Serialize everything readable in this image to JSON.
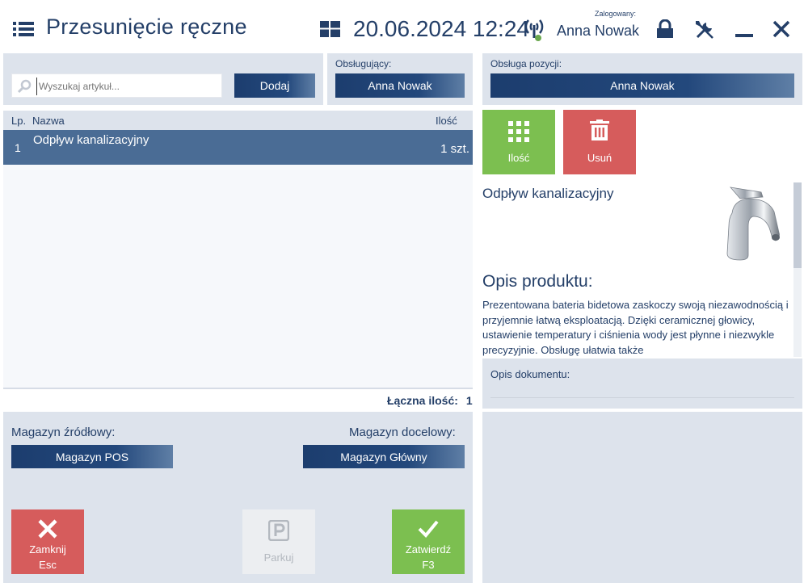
{
  "header": {
    "title": "Przesunięcie ręczne",
    "datetime": "20.06.2024 12:24",
    "logged_label": "Zalogowany:",
    "logged_user": "Anna Nowak"
  },
  "search": {
    "placeholder": "Wyszukaj artykuł...",
    "add_label": "Dodaj"
  },
  "operator": {
    "label": "Obsługujący:",
    "value": "Anna Nowak"
  },
  "position_operator": {
    "label": "Obsługa pozycji:",
    "value": "Anna Nowak"
  },
  "table": {
    "columns": [
      "Lp.",
      "Nazwa",
      "Ilość"
    ],
    "rows": [
      {
        "lp": "1",
        "name": "Odpływ kanalizacyjny",
        "qty": "1 szt."
      }
    ],
    "total_label": "Łączna ilość:",
    "total_value": "1"
  },
  "actions": {
    "qty_label": "Ilość",
    "delete_label": "Usuń"
  },
  "product": {
    "name": "Odpływ kanalizacyjny",
    "description_title": "Opis produktu:",
    "description_text": "Prezentowana bateria bidetowa zaskoczy swoją niezawodnością i przyjemnie łatwą eksploatacją. Dzięki ceramicznej głowicy, ustawienie temperatury i ciśnienia wody jest płynne i niezwykle precyzyjnie. Obsługę ułatwia także"
  },
  "document": {
    "label": "Opis dokumentu:"
  },
  "warehouses": {
    "source_label": "Magazyn źródłowy:",
    "source_value": "Magazyn POS",
    "target_label": "Magazyn docelowy:",
    "target_value": "Magazyn Główny"
  },
  "footer": {
    "close_label": "Zamknij",
    "close_key": "Esc",
    "park_label": "Parkuj",
    "confirm_label": "Zatwierdź",
    "confirm_key": "F3"
  },
  "colors": {
    "primary": "#1c3d6e",
    "panel": "#dde3ec",
    "selected_row": "#4a6c95",
    "green": "#7bbf4c",
    "red": "#d45b5b",
    "text": "#243f68"
  }
}
